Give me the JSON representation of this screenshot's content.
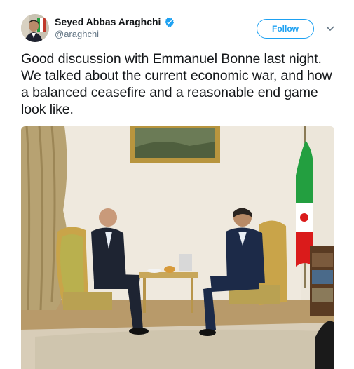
{
  "user": {
    "display_name": "Seyed Abbas Araghchi",
    "handle": "@araghchi",
    "verified_icon": "verified-badge-icon"
  },
  "actions": {
    "follow_label": "Follow",
    "menu_icon": "chevron-down-icon"
  },
  "tweet": {
    "text": "Good discussion with Emmanuel Bonne last night. We talked about the current economic war, and how a balanced ceasefire and a reasonable end game look like."
  },
  "colors": {
    "accent": "#1da1f2",
    "text": "#14171a",
    "secondary_text": "#657786"
  }
}
